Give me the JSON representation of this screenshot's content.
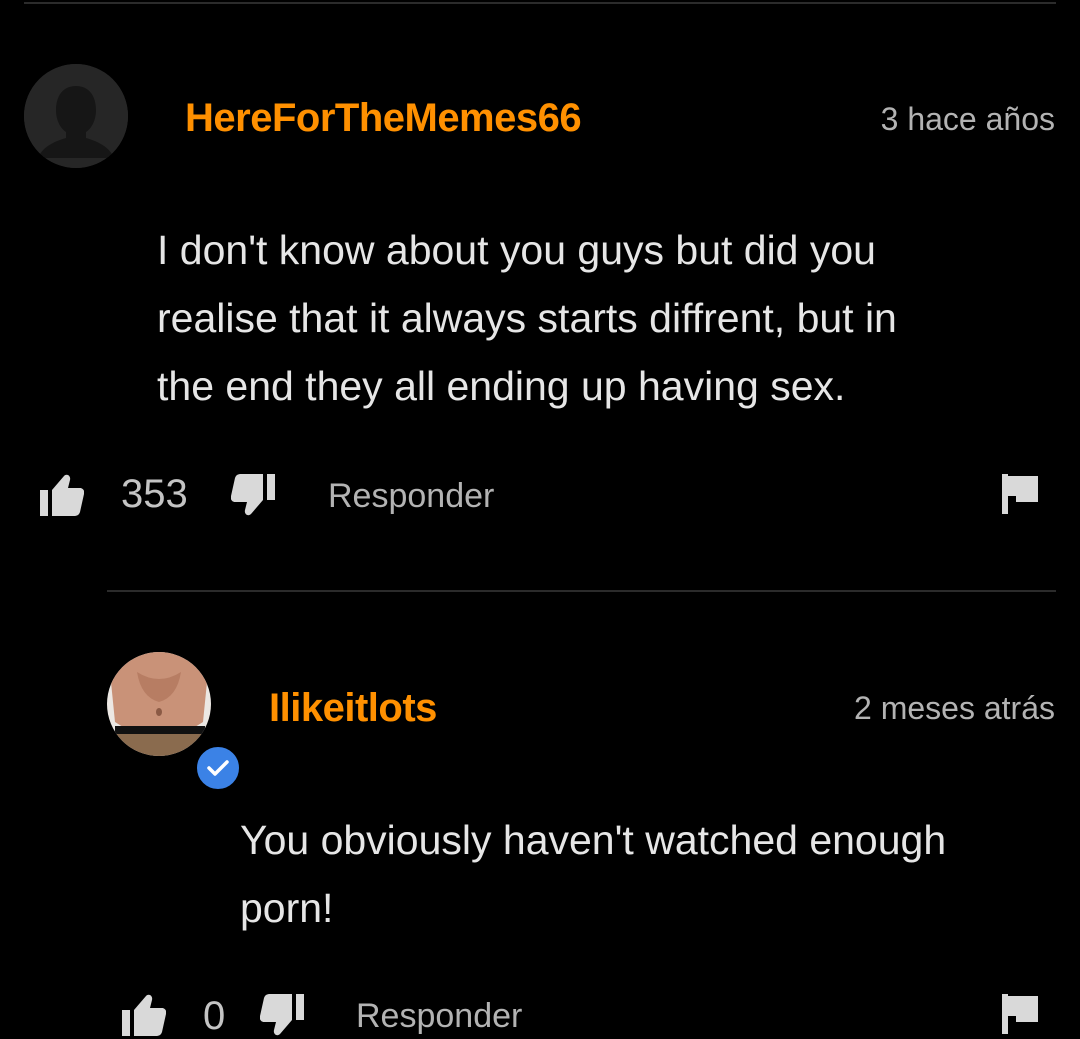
{
  "comments": [
    {
      "username": "HereForTheMemes66",
      "timestamp": "3 hace años",
      "text": "I don't know about you guys but did you\nrealise that it always starts diffrent, but in\nthe end they all ending up having sex.",
      "likes": "353",
      "reply_label": "Responder",
      "avatar": "default-user-silhouette",
      "verified": false
    },
    {
      "username": "Ilikeitlots",
      "timestamp": "2 meses atrás",
      "text": "You obviously haven't watched enough\nporn!",
      "likes": "0",
      "reply_label": "Responder",
      "avatar": "user-photo",
      "verified": true
    }
  ],
  "icons": {
    "like": "thumbs-up-icon",
    "dislike": "thumbs-down-icon",
    "report": "flag-icon",
    "verified": "verified-check-icon"
  },
  "colors": {
    "background": "#000000",
    "username": "#ff9000",
    "text": "#e6e6e6",
    "muted": "#b3b3b3",
    "verified": "#3b82e6"
  }
}
